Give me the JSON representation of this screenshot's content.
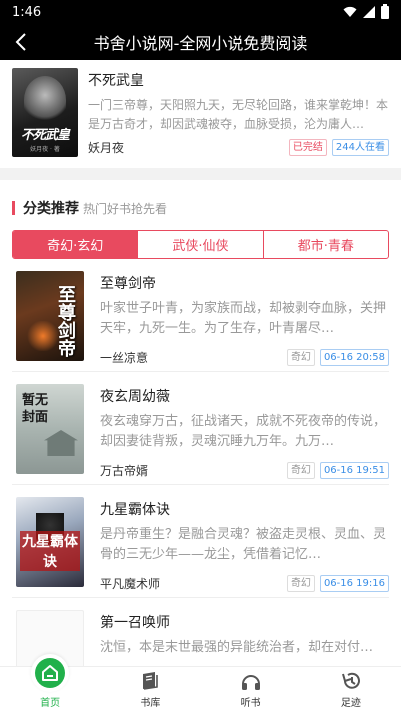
{
  "status": {
    "time": "1:46"
  },
  "header": {
    "title": "书舍小说网-全网小说免费阅读"
  },
  "top_book": {
    "title": "不死武皇",
    "description": "一门三帝尊，天阳照九天，无尽轮回路，谁来掌乾坤！本是万古奇才，却因武魂被夺，血脉受损，沦为庸人…",
    "author": "妖月夜",
    "status_tag": "已完结",
    "readers_tag": "244人在看",
    "cover_text": "不死武皇",
    "cover_sub": "妖月夜 · 著"
  },
  "section": {
    "title": "分类推荐",
    "subtitle": "热门好书抢先看",
    "tabs": [
      {
        "label": "奇幻·玄幻",
        "active": true
      },
      {
        "label": "武侠·仙侠",
        "active": false
      },
      {
        "label": "都市·青春",
        "active": false
      }
    ]
  },
  "books": [
    {
      "title": "至尊剑帝",
      "description": "叶家世子叶青，为家族而战，却被剥夺血脉，关押天牢，九死一生。为了生存，叶青屠尽…",
      "author": "一丝凉意",
      "genre": "奇幻",
      "time": "06-16 20:58",
      "cover_text": "至尊剑帝"
    },
    {
      "title": "夜玄周幼薇",
      "description": "夜玄魂穿万古，征战诸天，成就不死夜帝的传说，却因妻徒背叛，灵魂沉睡九万年。九万…",
      "author": "万古帝婿",
      "genre": "奇幻",
      "time": "06-16 19:51",
      "cover_text": "暂无封面"
    },
    {
      "title": "九星霸体诀",
      "description": "是丹帝重生？是融合灵魂？被盗走灵根、灵血、灵骨的三无少年——龙尘，凭借着记忆…",
      "author": "平凡魔术师",
      "genre": "奇幻",
      "time": "06-16 19:16",
      "cover_text": "九星霸体诀"
    },
    {
      "title": "第一召唤师",
      "description": "沈恒，本是末世最强的异能统治者，却在对付…"
    }
  ],
  "nav": [
    {
      "label": "首页",
      "icon": "home-icon",
      "active": true
    },
    {
      "label": "书库",
      "icon": "book-icon",
      "active": false
    },
    {
      "label": "听书",
      "icon": "headphones-icon",
      "active": false
    },
    {
      "label": "足迹",
      "icon": "history-icon",
      "active": false
    }
  ],
  "colors": {
    "accent": "#e84a5f",
    "nav_active": "#21b04b",
    "link_blue": "#3a8ee6"
  }
}
